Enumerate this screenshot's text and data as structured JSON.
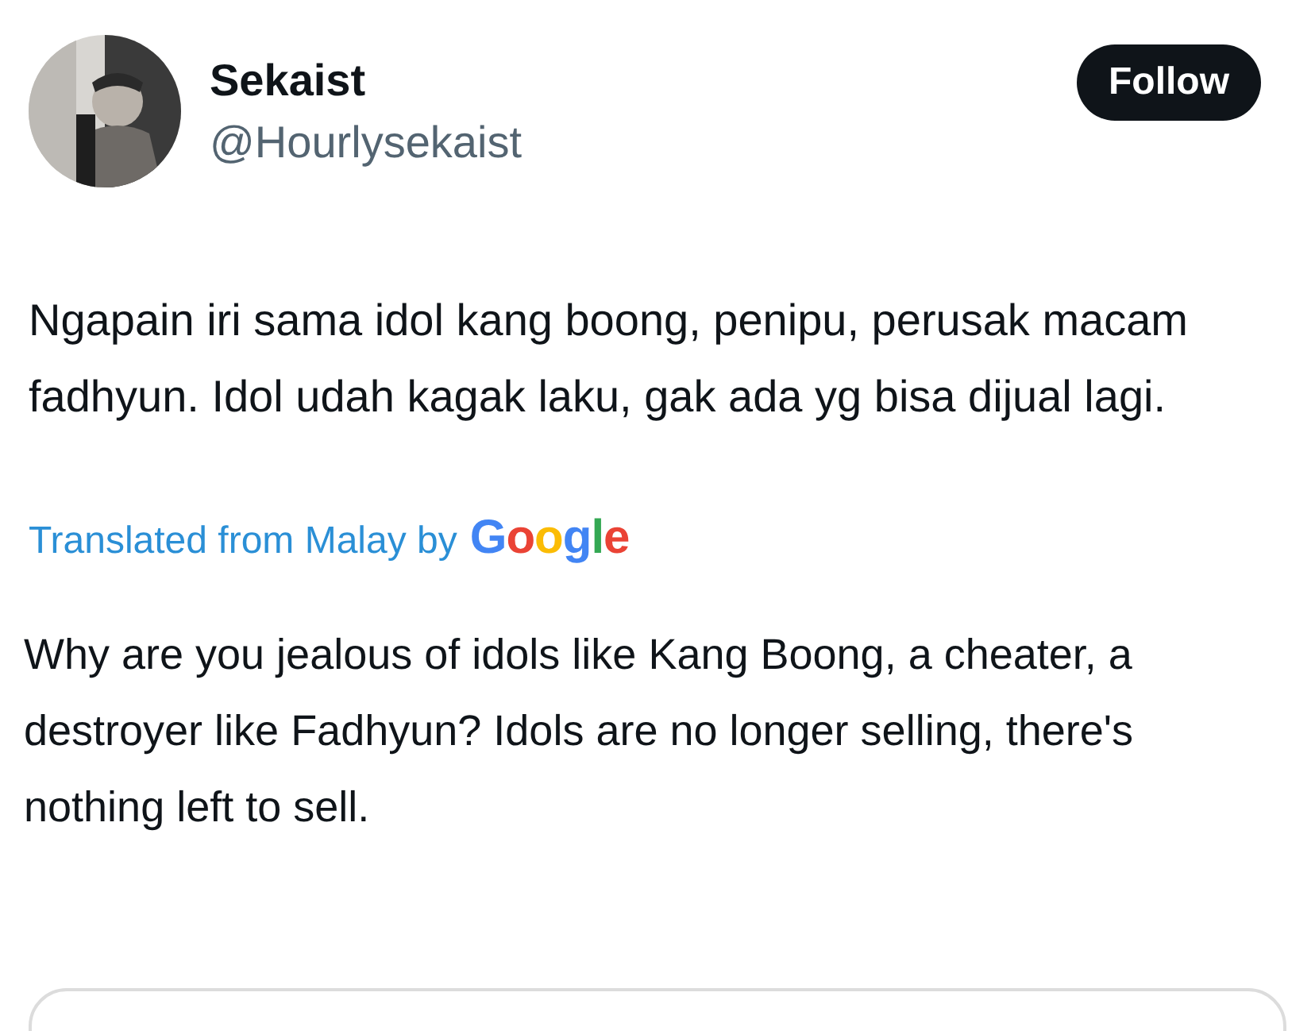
{
  "author": {
    "kind": "picture",
    "name": "Sekaist",
    "handle": "@Hourlysekaist"
  },
  "follow_button": {
    "label": "Follow"
  },
  "tweet": {
    "text": "Ngapain iri sama idol kang boong, penipu, perusak macam fadhyun.  Idol udah kagak laku, gak ada yg bisa dijual lagi."
  },
  "translation": {
    "label": "Translated from Malay by",
    "provider": "Google",
    "text": "Why are you jealous of idols like Kang Boong, a cheater, a destroyer like Fadhyun? Idols are no longer selling, there's nothing left to sell."
  }
}
